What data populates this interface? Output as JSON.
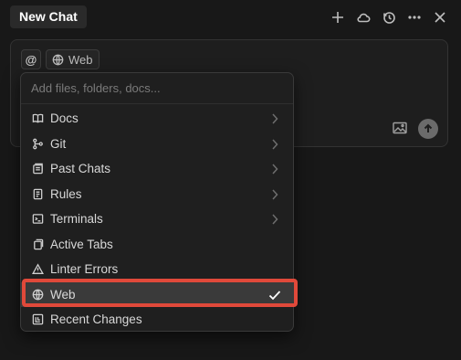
{
  "header": {
    "tab_label": "New Chat",
    "actions": [
      {
        "name": "plus-icon"
      },
      {
        "name": "cloud-icon"
      },
      {
        "name": "history-icon"
      },
      {
        "name": "more-icon"
      },
      {
        "name": "close-icon"
      }
    ]
  },
  "composer": {
    "at_label": "@",
    "chip_label": "Web",
    "chip_icon": "globe-icon"
  },
  "dropdown": {
    "placeholder": "Add files, folders, docs...",
    "items": [
      {
        "label": "Docs",
        "icon": "book-icon",
        "has_submenu": true
      },
      {
        "label": "Git",
        "icon": "git-icon",
        "has_submenu": true
      },
      {
        "label": "Past Chats",
        "icon": "chat-history-icon",
        "has_submenu": true
      },
      {
        "label": "Rules",
        "icon": "rules-icon",
        "has_submenu": true
      },
      {
        "label": "Terminals",
        "icon": "terminal-icon",
        "has_submenu": true
      },
      {
        "label": "Active Tabs",
        "icon": "tabs-icon",
        "has_submenu": false
      },
      {
        "label": "Linter Errors",
        "icon": "warning-icon",
        "has_submenu": false
      },
      {
        "label": "Web",
        "icon": "globe-icon",
        "has_submenu": false,
        "selected": true
      },
      {
        "label": "Recent Changes",
        "icon": "recent-changes-icon",
        "has_submenu": false
      }
    ]
  },
  "colors": {
    "background": "#181818",
    "highlight": "#e0493a",
    "selected_row": "#3a3a3a"
  }
}
